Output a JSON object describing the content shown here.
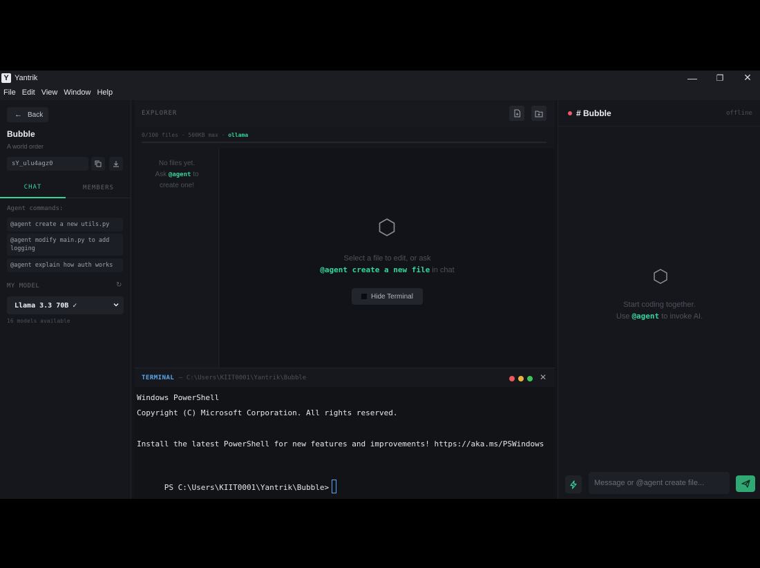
{
  "app": {
    "title": "Yantrik",
    "icon_letter": "Y"
  },
  "window_controls": {
    "minimize": "—",
    "restore": "❐",
    "close": "✕"
  },
  "menu": [
    "File",
    "Edit",
    "View",
    "Window",
    "Help"
  ],
  "sidebar": {
    "back_label": "Back",
    "room_name": "Bubble",
    "room_subtitle": "A world order",
    "room_code": "sY_ulu4agz0",
    "tabs": [
      "CHAT",
      "MEMBERS"
    ],
    "agent_commands_heading": "Agent commands:",
    "agent_commands": [
      "@agent create a new utils.py",
      "@agent modify main.py to add logging",
      "@agent explain how auth works"
    ],
    "model_heading": "MY MODEL",
    "model_selected": "Llama 3.3 70B ✓",
    "models_available": "16 models available"
  },
  "explorer": {
    "title": "EXPLORER",
    "stats_prefix": "0/100 files · 500KB max · ",
    "stats_provider": "ollama",
    "no_files_line1": "No files yet.",
    "no_files_ask": "Ask ",
    "no_files_agent": "@agent",
    "no_files_to": " to",
    "no_files_line3": "create one!",
    "hint_line1": "Select a file to edit, or ask",
    "hint_command": "@agent create a new file",
    "hint_suffix": " in chat",
    "hide_terminal_label": "Hide Terminal"
  },
  "terminal": {
    "title": "TERMINAL",
    "path": "— C:\\Users\\KIIT0001\\Yantrik\\Bubble",
    "close": "✕",
    "dot_colors": [
      "#f0565e",
      "#e9b43c",
      "#3fc456"
    ],
    "lines": [
      "Windows PowerShell",
      "Copyright (C) Microsoft Corporation. All rights reserved.",
      "",
      "Install the latest PowerShell for new features and improvements! https://aka.ms/PSWindows",
      "",
      "PS C:\\Users\\KIIT0001\\Yantrik\\Bubble>"
    ]
  },
  "chat": {
    "room_title": "# Bubble",
    "status": "offline",
    "empty_line1": "Start coding together.",
    "empty_use": "Use ",
    "empty_agent": "@agent",
    "empty_suffix": " to invoke AI.",
    "input_placeholder": "Message or @agent create file..."
  },
  "colors": {
    "accent": "#34d49a",
    "terminal_title": "#5aa9f0",
    "live_dot": "#f05a6a"
  }
}
